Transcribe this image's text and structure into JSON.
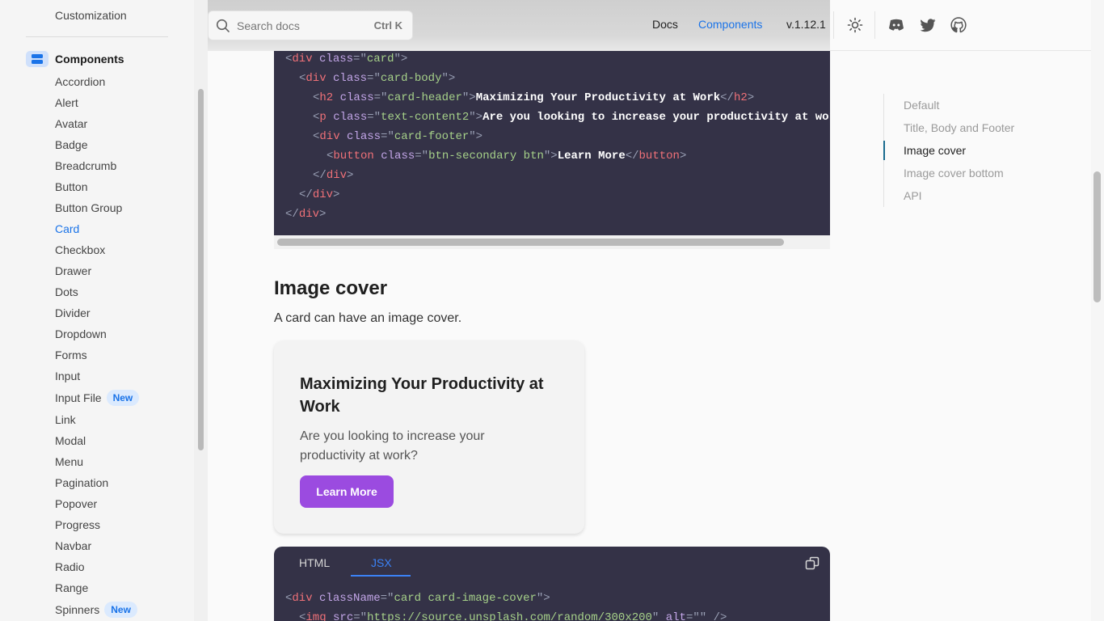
{
  "sidebar": {
    "top_item": "Customization",
    "section_label": "Components",
    "items": [
      {
        "label": "Accordion",
        "badge": null,
        "active": false
      },
      {
        "label": "Alert",
        "badge": null,
        "active": false
      },
      {
        "label": "Avatar",
        "badge": null,
        "active": false
      },
      {
        "label": "Badge",
        "badge": null,
        "active": false
      },
      {
        "label": "Breadcrumb",
        "badge": null,
        "active": false
      },
      {
        "label": "Button",
        "badge": null,
        "active": false
      },
      {
        "label": "Button Group",
        "badge": null,
        "active": false
      },
      {
        "label": "Card",
        "badge": null,
        "active": true
      },
      {
        "label": "Checkbox",
        "badge": null,
        "active": false
      },
      {
        "label": "Drawer",
        "badge": null,
        "active": false
      },
      {
        "label": "Dots",
        "badge": null,
        "active": false
      },
      {
        "label": "Divider",
        "badge": null,
        "active": false
      },
      {
        "label": "Dropdown",
        "badge": null,
        "active": false
      },
      {
        "label": "Forms",
        "badge": null,
        "active": false
      },
      {
        "label": "Input",
        "badge": null,
        "active": false
      },
      {
        "label": "Input File",
        "badge": "New",
        "active": false
      },
      {
        "label": "Link",
        "badge": null,
        "active": false
      },
      {
        "label": "Modal",
        "badge": null,
        "active": false
      },
      {
        "label": "Menu",
        "badge": null,
        "active": false
      },
      {
        "label": "Pagination",
        "badge": null,
        "active": false
      },
      {
        "label": "Popover",
        "badge": null,
        "active": false
      },
      {
        "label": "Progress",
        "badge": null,
        "active": false
      },
      {
        "label": "Navbar",
        "badge": null,
        "active": false
      },
      {
        "label": "Radio",
        "badge": null,
        "active": false
      },
      {
        "label": "Range",
        "badge": null,
        "active": false
      },
      {
        "label": "Spinners",
        "badge": "New",
        "active": false
      }
    ]
  },
  "header": {
    "search_placeholder": "Search docs",
    "search_shortcut": "Ctrl K",
    "nav": {
      "docs": "Docs",
      "components": "Components",
      "version": "v.1.12.1"
    },
    "icons": [
      "sun-icon",
      "discord-icon",
      "twitter-icon",
      "github-icon"
    ]
  },
  "code_top": {
    "lines": [
      {
        "indent": "",
        "parts": [
          [
            "punc",
            "<"
          ],
          [
            "tag",
            "div"
          ],
          [
            "plain",
            " "
          ],
          [
            "attr",
            "class"
          ],
          [
            "punc",
            "=\""
          ],
          [
            "str",
            "card"
          ],
          [
            "punc",
            "\">"
          ]
        ]
      },
      {
        "indent": "  ",
        "parts": [
          [
            "punc",
            "<"
          ],
          [
            "tag",
            "div"
          ],
          [
            "plain",
            " "
          ],
          [
            "attr",
            "class"
          ],
          [
            "punc",
            "=\""
          ],
          [
            "str",
            "card-body"
          ],
          [
            "punc",
            "\">"
          ]
        ]
      },
      {
        "indent": "    ",
        "parts": [
          [
            "punc",
            "<"
          ],
          [
            "tag",
            "h2"
          ],
          [
            "plain",
            " "
          ],
          [
            "attr",
            "class"
          ],
          [
            "punc",
            "=\""
          ],
          [
            "str",
            "card-header"
          ],
          [
            "punc",
            "\">"
          ],
          [
            "text",
            "Maximizing Your Productivity at Work"
          ],
          [
            "punc",
            "</"
          ],
          [
            "tag",
            "h2"
          ],
          [
            "punc",
            ">"
          ]
        ]
      },
      {
        "indent": "    ",
        "parts": [
          [
            "punc",
            "<"
          ],
          [
            "tag",
            "p"
          ],
          [
            "plain",
            " "
          ],
          [
            "attr",
            "class"
          ],
          [
            "punc",
            "=\""
          ],
          [
            "str",
            "text-content2"
          ],
          [
            "punc",
            "\">"
          ],
          [
            "text",
            "Are you looking to increase your productivity at work?"
          ],
          [
            "punc",
            "</"
          ],
          [
            "tag",
            "p"
          ],
          [
            "punc",
            ">"
          ]
        ]
      },
      {
        "indent": "    ",
        "parts": [
          [
            "punc",
            "<"
          ],
          [
            "tag",
            "div"
          ],
          [
            "plain",
            " "
          ],
          [
            "attr",
            "class"
          ],
          [
            "punc",
            "=\""
          ],
          [
            "str",
            "card-footer"
          ],
          [
            "punc",
            "\">"
          ]
        ]
      },
      {
        "indent": "      ",
        "parts": [
          [
            "punc",
            "<"
          ],
          [
            "tag",
            "button"
          ],
          [
            "plain",
            " "
          ],
          [
            "attr",
            "class"
          ],
          [
            "punc",
            "=\""
          ],
          [
            "str",
            "btn-secondary btn"
          ],
          [
            "punc",
            "\">"
          ],
          [
            "text",
            "Learn More"
          ],
          [
            "punc",
            "</"
          ],
          [
            "tag",
            "button"
          ],
          [
            "punc",
            ">"
          ]
        ]
      },
      {
        "indent": "    ",
        "parts": [
          [
            "punc",
            "</"
          ],
          [
            "tag",
            "div"
          ],
          [
            "punc",
            ">"
          ]
        ]
      },
      {
        "indent": "  ",
        "parts": [
          [
            "punc",
            "</"
          ],
          [
            "tag",
            "div"
          ],
          [
            "punc",
            ">"
          ]
        ]
      },
      {
        "indent": "",
        "parts": [
          [
            "punc",
            "</"
          ],
          [
            "tag",
            "div"
          ],
          [
            "punc",
            ">"
          ]
        ]
      }
    ]
  },
  "section": {
    "title": "Image cover",
    "description": "A card can have an image cover."
  },
  "card": {
    "header": "Maximizing Your Productivity at Work",
    "text": "Are you looking to increase your productivity at work?",
    "button": "Learn More"
  },
  "code_bottom": {
    "tabs": {
      "html": "HTML",
      "jsx": "JSX"
    },
    "active_tab": "JSX",
    "lines": [
      {
        "indent": "",
        "parts": [
          [
            "punc",
            "<"
          ],
          [
            "tag",
            "div"
          ],
          [
            "plain",
            " "
          ],
          [
            "attr",
            "className"
          ],
          [
            "punc",
            "=\""
          ],
          [
            "str",
            "card card-image-cover"
          ],
          [
            "punc",
            "\">"
          ]
        ]
      },
      {
        "indent": "  ",
        "parts": [
          [
            "punc",
            "<"
          ],
          [
            "tag",
            "img"
          ],
          [
            "plain",
            " "
          ],
          [
            "attr",
            "src"
          ],
          [
            "punc",
            "=\""
          ],
          [
            "str",
            "https://source.unsplash.com/random/300x200"
          ],
          [
            "punc",
            "\""
          ],
          [
            "plain",
            " "
          ],
          [
            "attr",
            "alt"
          ],
          [
            "punc",
            "=\"\""
          ],
          [
            "plain",
            " "
          ],
          [
            "punc",
            "/>"
          ]
        ]
      }
    ]
  },
  "toc": {
    "items": [
      {
        "label": "Default",
        "active": false
      },
      {
        "label": "Title, Body and Footer",
        "active": false
      },
      {
        "label": "Image cover",
        "active": true
      },
      {
        "label": "Image cover bottom",
        "active": false
      },
      {
        "label": "API",
        "active": false
      }
    ]
  },
  "colors": {
    "accent": "#1a73e8",
    "button_purple": "#9b4be0",
    "code_bg": "#343247",
    "toc_active_bar": "#1a6b8f"
  }
}
